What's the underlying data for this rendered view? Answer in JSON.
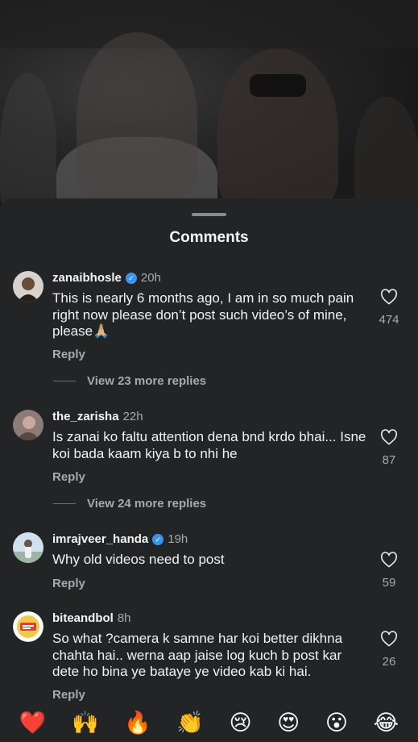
{
  "sheet": {
    "title": "Comments"
  },
  "comments": [
    {
      "username": "zanaibhosle",
      "verified": true,
      "time": "20h",
      "text": "This is nearly 6 months ago, I am in so much pain right now please don’t post such video’s of mine, please🙏🏼",
      "reply_label": "Reply",
      "more_replies": "View 23 more replies",
      "likes": "474"
    },
    {
      "username": "the_zarisha",
      "verified": false,
      "time": "22h",
      "text": "Is zanai ko faltu attention dena bnd krdo bhai... Isne koi bada kaam kiya b to nhi he",
      "reply_label": "Reply",
      "more_replies": "View 24 more replies",
      "likes": "87"
    },
    {
      "username": "imrajveer_handa",
      "verified": true,
      "time": "19h",
      "text": "Why old videos need to post",
      "reply_label": "Reply",
      "likes": "59"
    },
    {
      "username": "biteandbol",
      "verified": false,
      "time": "8h",
      "text": "So what ?camera k samne har koi better dikhna chahta hai.. werna aap jaise log kuch b post kar dete ho bina ye bataye ye video kab ki hai.",
      "reply_label": "Reply",
      "likes": "26"
    }
  ],
  "emoji_bar": [
    "❤️",
    "🙌",
    "🔥",
    "👏",
    "😢",
    "😍",
    "😮",
    "😂"
  ],
  "icons": {
    "like": "heart-outline-icon",
    "verified": "verified-badge-icon"
  },
  "colors": {
    "sheet_bg": "#232426",
    "verified": "#3797f0",
    "secondary_text": "#a8a9ac"
  }
}
